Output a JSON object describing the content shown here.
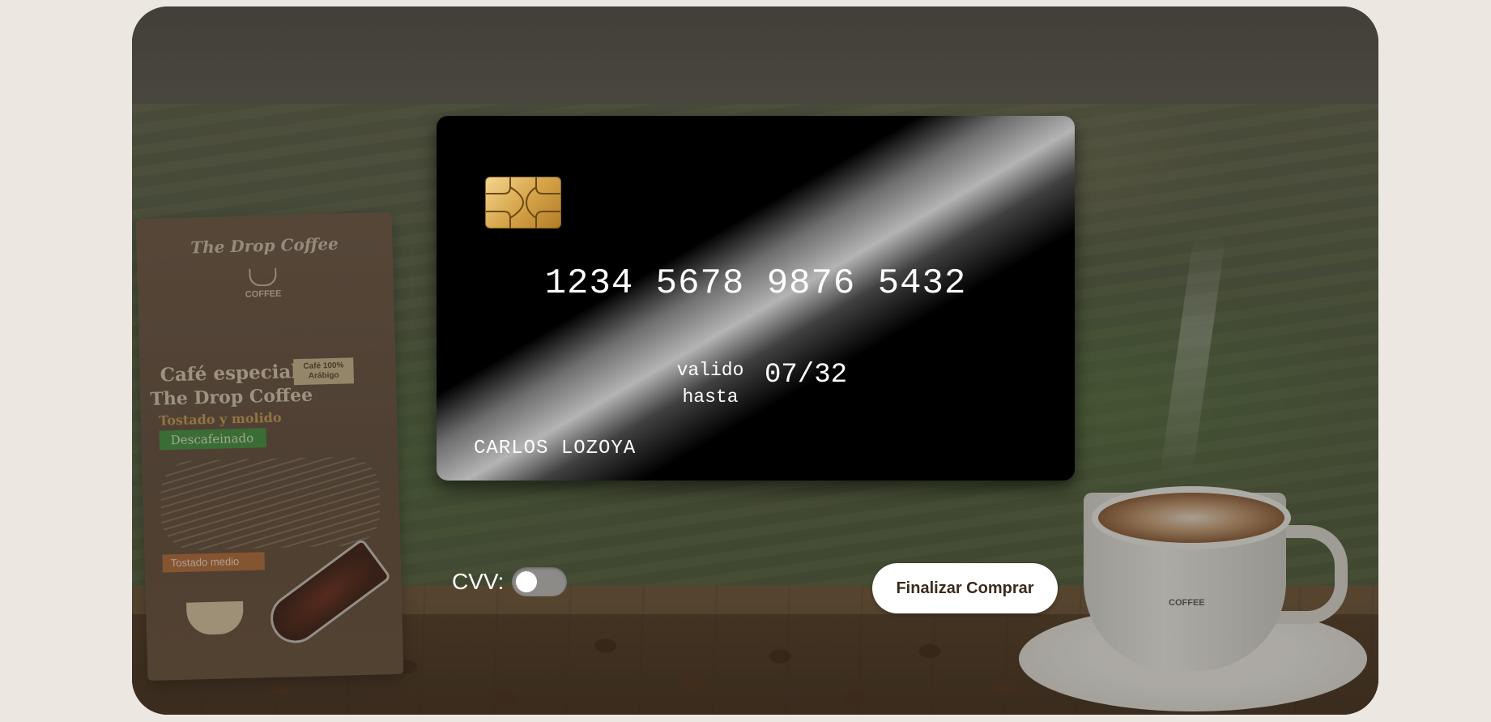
{
  "card": {
    "number": "1234 5678 9876 5432",
    "valid_label": "valido hasta",
    "valid_date": "07/32",
    "holder": "CARLOS LOZOYA"
  },
  "form": {
    "cvv_label": "CVV:",
    "cvv_toggle_on": false,
    "finish_button": "Finalizar Comprar"
  },
  "background": {
    "bag_brand": "The Drop Coffee",
    "bag_title": "Café especial",
    "bag_title2": "The Drop Coffee",
    "bag_tag": "Café 100% Arábigo",
    "bag_sub": "Tostado y molido",
    "bag_green": "Descafeinado",
    "bag_orange": "Tostado medio",
    "bag_logo_text": "COFFEE",
    "mug_logo_text": "COFFEE"
  },
  "colors": {
    "page_bg": "#ece7e1",
    "card_bg": "#000000",
    "button_bg": "#ffffff",
    "button_text": "#3b2a1c"
  }
}
